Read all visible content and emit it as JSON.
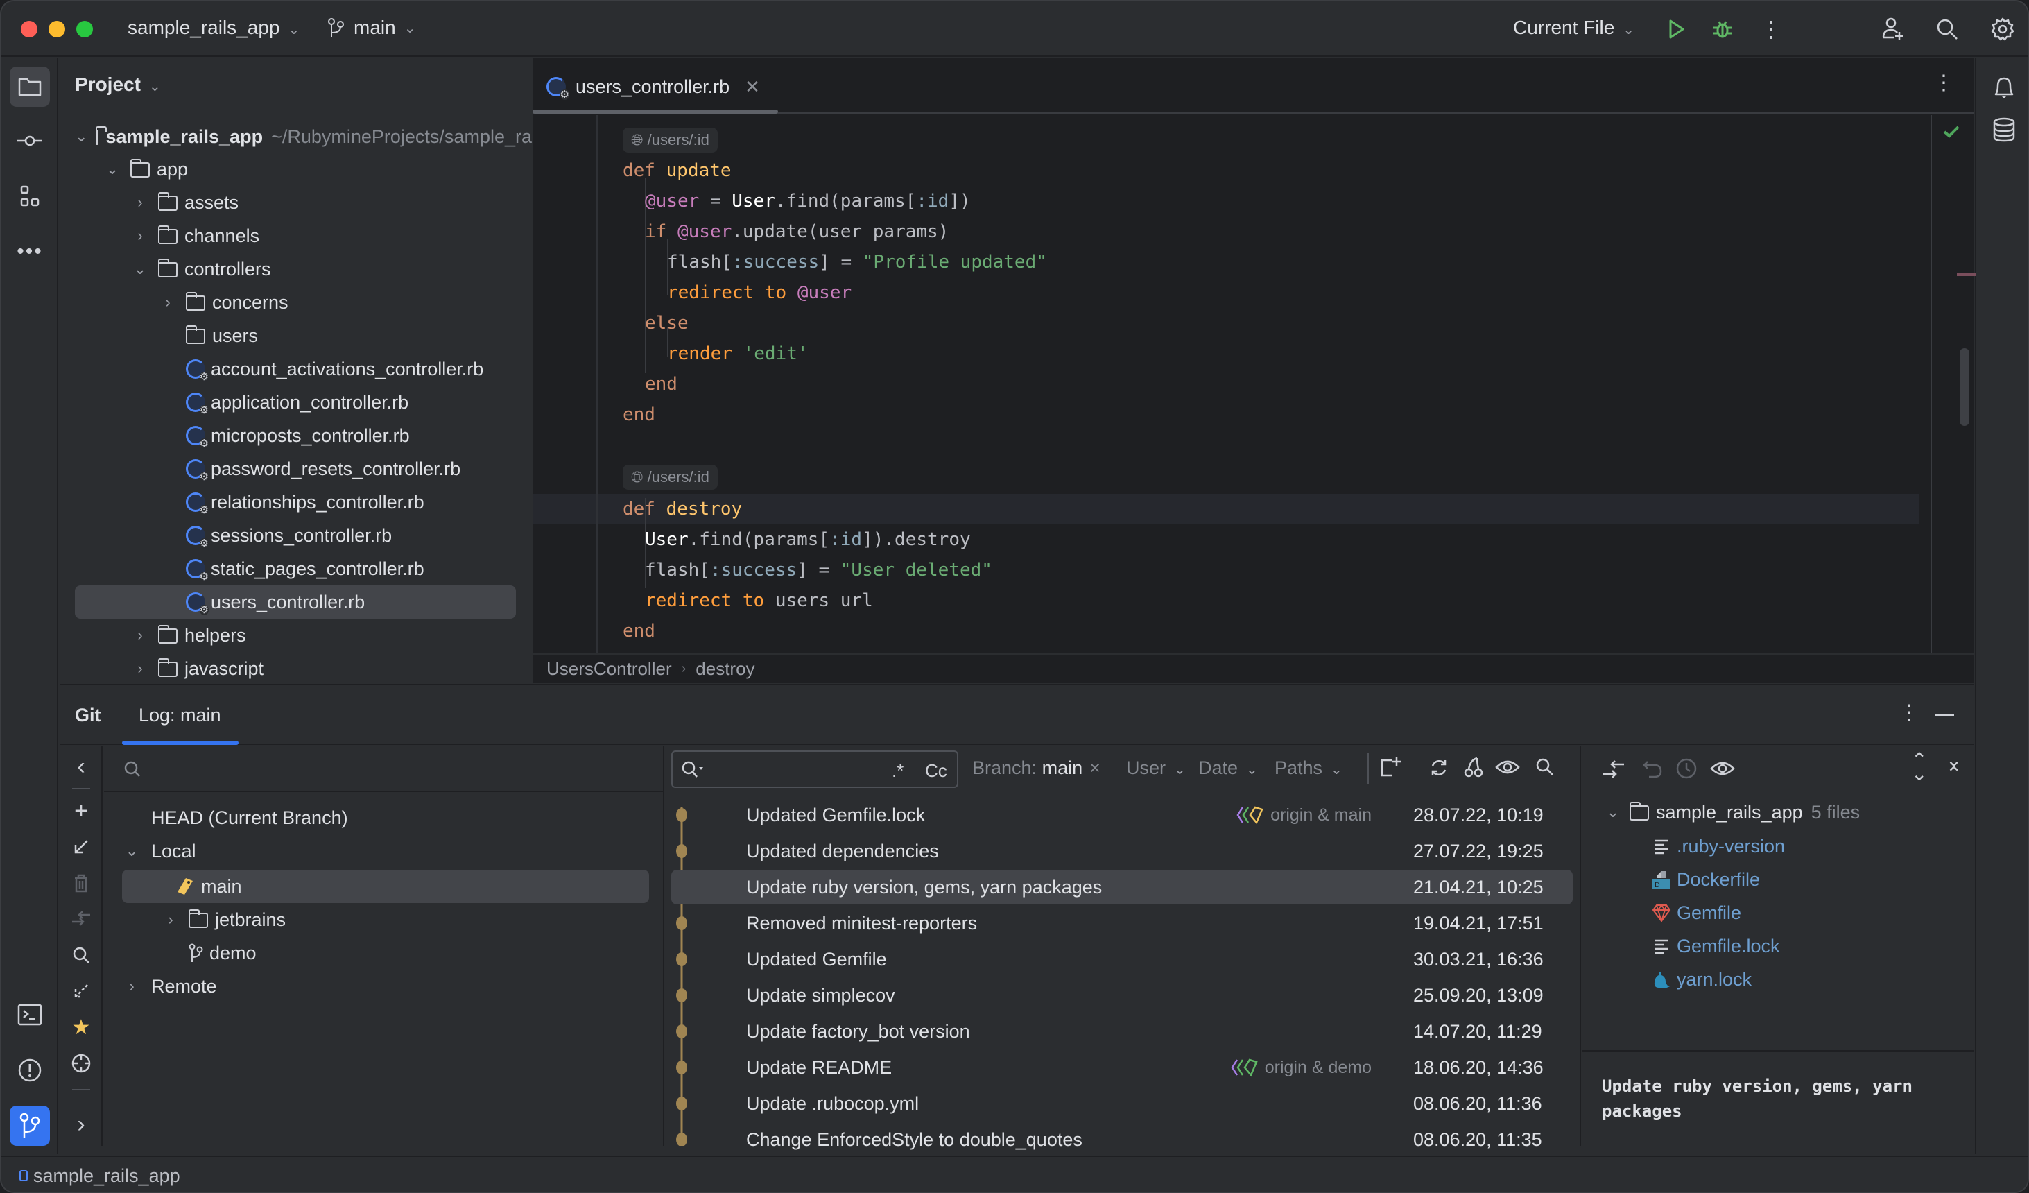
{
  "titlebar": {
    "project_name": "sample_rails_app",
    "branch": "main",
    "run_config": "Current File",
    "colors": {
      "close": "#ff5f57",
      "minimize": "#febc2e",
      "maximize": "#28c840",
      "run": "#5fb865"
    }
  },
  "left_strip": {
    "top_items": [
      "folder-icon",
      "commit-icon",
      "structure-icon",
      "more-icon"
    ],
    "bottom_items": [
      "terminal-icon",
      "problems-icon",
      "git-icon"
    ]
  },
  "right_strip": {
    "items": [
      "bell-icon",
      "database-icon"
    ]
  },
  "project_panel": {
    "title": "Project",
    "root": {
      "name": "sample_rails_app",
      "path": "~/RubymineProjects/sample_rails_app"
    },
    "tree": [
      {
        "label": "app",
        "type": "folder",
        "depth": 1,
        "expanded": true
      },
      {
        "label": "assets",
        "type": "folder",
        "depth": 2,
        "expanded": false
      },
      {
        "label": "channels",
        "type": "folder",
        "depth": 2,
        "expanded": false
      },
      {
        "label": "controllers",
        "type": "folder",
        "depth": 2,
        "expanded": true
      },
      {
        "label": "concerns",
        "type": "folder",
        "depth": 3,
        "expanded": false
      },
      {
        "label": "users",
        "type": "folder",
        "depth": 3,
        "leaf": true
      },
      {
        "label": "account_activations_controller.rb",
        "type": "ruby",
        "depth": 3
      },
      {
        "label": "application_controller.rb",
        "type": "ruby",
        "depth": 3
      },
      {
        "label": "microposts_controller.rb",
        "type": "ruby",
        "depth": 3
      },
      {
        "label": "password_resets_controller.rb",
        "type": "ruby",
        "depth": 3
      },
      {
        "label": "relationships_controller.rb",
        "type": "ruby",
        "depth": 3
      },
      {
        "label": "sessions_controller.rb",
        "type": "ruby",
        "depth": 3
      },
      {
        "label": "static_pages_controller.rb",
        "type": "ruby",
        "depth": 3
      },
      {
        "label": "users_controller.rb",
        "type": "ruby",
        "depth": 3,
        "selected": true
      },
      {
        "label": "helpers",
        "type": "folder",
        "depth": 2,
        "expanded": false
      },
      {
        "label": "javascript",
        "type": "folder",
        "depth": 2,
        "expanded": false
      }
    ]
  },
  "editor": {
    "tab": {
      "filename": "users_controller.rb"
    },
    "route_hint": "/users/:id",
    "breadcrumb": [
      "UsersController",
      "destroy"
    ],
    "code": {
      "update": {
        "def": "def",
        "name": "update",
        "l1": {
          "ivar": "@user",
          "eq": " = ",
          "cls": "User",
          "rest1": ".find(params[",
          "sym": ":id",
          "rest2": "])"
        },
        "l2": {
          "kw": "if",
          "ivar": "@user",
          "rest": ".update(user_params)"
        },
        "l3": {
          "a": "flash[",
          "sym": ":success",
          "b": "] = ",
          "str": "\"Profile updated\""
        },
        "l4": {
          "met": "redirect_to",
          "ivar": "@user"
        },
        "l5": "else",
        "l6": {
          "met": "render",
          "str": "'edit'"
        },
        "l7": "end",
        "l8": "end"
      },
      "destroy": {
        "def": "def",
        "name": "destroy",
        "l1": {
          "cls": "User",
          "a": ".find(params[",
          "sym": ":id",
          "b": "]).destroy"
        },
        "l2": {
          "a": "flash[",
          "sym": ":success",
          "b": "] = ",
          "str": "\"User deleted\""
        },
        "l3": {
          "met": "redirect_to",
          "rest": "users_url"
        },
        "l4": "end"
      }
    }
  },
  "git": {
    "title": "Git",
    "tab": "Log: main",
    "branches": {
      "head": "HEAD (Current Branch)",
      "local": "Local",
      "local_items": [
        {
          "label": "main",
          "icon": "tag-icon",
          "selected": true
        },
        {
          "label": "jetbrains",
          "icon": "folder-icon"
        },
        {
          "label": "demo",
          "icon": "branch-icon"
        }
      ],
      "remote": "Remote"
    },
    "log_toolbar": {
      "regex_label": ".*",
      "case_label": "Cc",
      "branch_filter_label": "Branch:",
      "branch_filter_value": "main",
      "user_label": "User",
      "date_label": "Date",
      "paths_label": "Paths"
    },
    "commits": [
      {
        "message": "Updated Gemfile.lock",
        "refs": "origin & main",
        "date": "28.07.22, 10:19"
      },
      {
        "message": "Updated dependencies",
        "refs": "",
        "date": "27.07.22, 19:25"
      },
      {
        "message": "Update ruby version, gems, yarn packages",
        "refs": "",
        "date": "21.04.21, 10:25",
        "selected": true
      },
      {
        "message": "Removed minitest-reporters",
        "refs": "",
        "date": "19.04.21, 17:51"
      },
      {
        "message": "Updated Gemfile",
        "refs": "",
        "date": "30.03.21, 16:36"
      },
      {
        "message": "Update simplecov",
        "refs": "",
        "date": "25.09.20, 13:09"
      },
      {
        "message": "Update factory_bot version",
        "refs": "",
        "date": "14.07.20, 11:29"
      },
      {
        "message": "Update README",
        "refs": "origin & demo",
        "date": "18.06.20, 14:36"
      },
      {
        "message": "Update .rubocop.yml",
        "refs": "",
        "date": "08.06.20, 11:36"
      },
      {
        "message": "Change EnforcedStyle to double_quotes",
        "refs": "",
        "date": "08.06.20, 11:35"
      }
    ],
    "changes": {
      "root": "sample_rails_app",
      "count": "5 files",
      "files": [
        {
          "name": ".ruby-version",
          "icon": "text-file-icon"
        },
        {
          "name": "Dockerfile",
          "icon": "docker-icon"
        },
        {
          "name": "Gemfile",
          "icon": "gem-icon"
        },
        {
          "name": "Gemfile.lock",
          "icon": "text-file-icon"
        },
        {
          "name": "yarn.lock",
          "icon": "yarn-icon"
        }
      ],
      "commit_message": "Update ruby version, gems, yarn packages"
    },
    "graph_color": "#a08552"
  },
  "statusbar": {
    "project": "sample_rails_app"
  }
}
